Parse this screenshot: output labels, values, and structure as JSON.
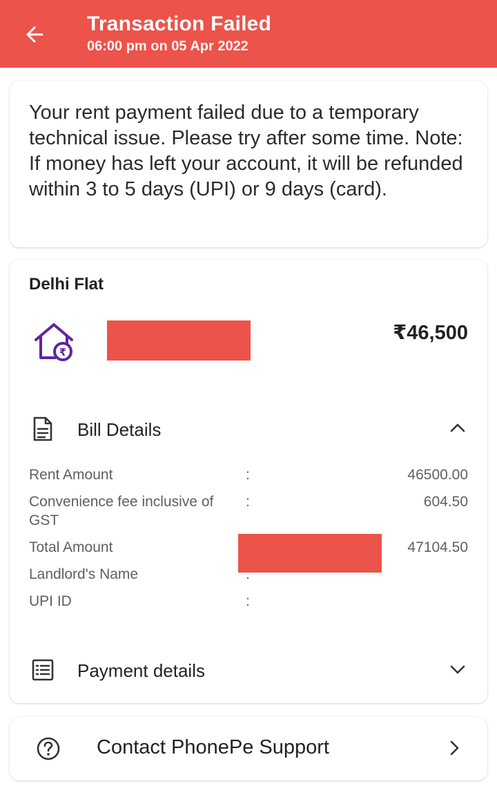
{
  "header": {
    "title": "Transaction Failed",
    "subtitle": "06:00 pm on 05 Apr 2022",
    "back_icon": "arrow-left-icon",
    "background_color": "#ec534a"
  },
  "message": {
    "text": "Your rent payment failed due to a temporary technical issue. Please try after some time. Note: If money has left your account, it will be refunded within 3 to 5 days (UPI) or 9 days (card)."
  },
  "payee": {
    "name": "Delhi Flat",
    "icon": "house-rupee-icon",
    "icon_color": "#5f259f",
    "amount": "₹46,500"
  },
  "bill_details": {
    "label": "Bill Details",
    "icon": "document-icon",
    "expanded": true,
    "rows": [
      {
        "label": "Rent Amount",
        "separator": ":",
        "value": "46500.00"
      },
      {
        "label": "Convenience fee inclusive of GST",
        "separator": ":",
        "value": "604.50"
      },
      {
        "label": "Total Amount",
        "separator": ":",
        "value": "47104.50"
      },
      {
        "label": "Landlord's Name",
        "separator": ":",
        "value": ""
      },
      {
        "label": "UPI ID",
        "separator": ":",
        "value": ""
      }
    ]
  },
  "payment_details": {
    "label": "Payment details",
    "icon": "receipt-list-icon",
    "expanded": false
  },
  "support": {
    "label": "Contact PhonePe Support",
    "icon": "help-circle-icon"
  }
}
